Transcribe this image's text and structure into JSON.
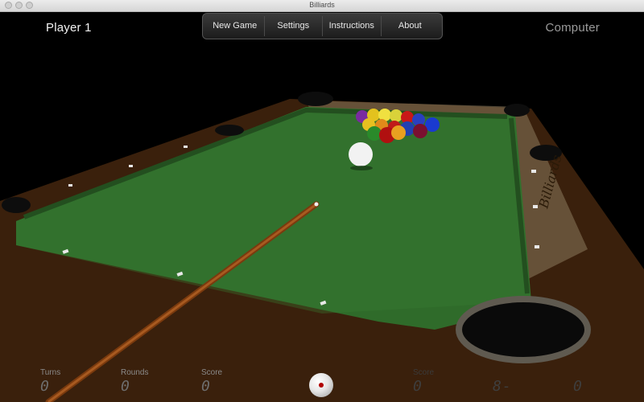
{
  "window": {
    "title": "Billiards"
  },
  "players": {
    "left": "Player 1",
    "right": "Computer"
  },
  "menu": {
    "items": [
      "New Game",
      "Settings",
      "Instructions",
      "About"
    ]
  },
  "hud": {
    "turns_label": "Turns",
    "turns_value": "0",
    "rounds_label": "Rounds",
    "rounds_value": "0",
    "score_label": "Score",
    "score_value": "0",
    "right_score_label": "Score",
    "right_score_value": "0",
    "right_extra_value": "8-",
    "right_last_value": "0"
  },
  "table": {
    "felt_color": "#2f6b2a",
    "rail_color": "#4a2a12",
    "cue_color": "#8a3f10"
  }
}
